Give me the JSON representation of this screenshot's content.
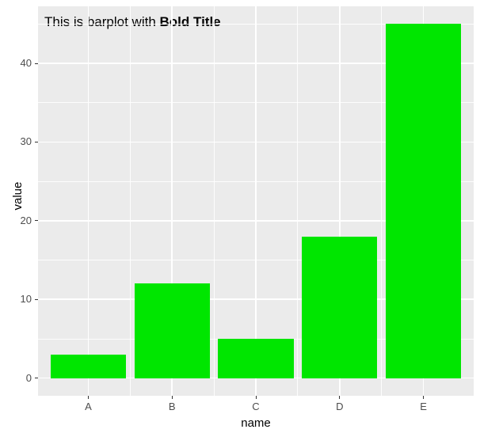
{
  "chart_data": {
    "type": "bar",
    "categories": [
      "A",
      "B",
      "C",
      "D",
      "E"
    ],
    "values": [
      3,
      12,
      5,
      18,
      45
    ],
    "title_prefix": "This is barplot with ",
    "title_bold": "Bold Title",
    "xlabel": "name",
    "ylabel": "value",
    "ylim": [
      0,
      45
    ],
    "yticks": [
      0,
      10,
      20,
      30,
      40
    ],
    "bar_fill": "#00E600",
    "panel_bg": "#EBEBEB"
  }
}
